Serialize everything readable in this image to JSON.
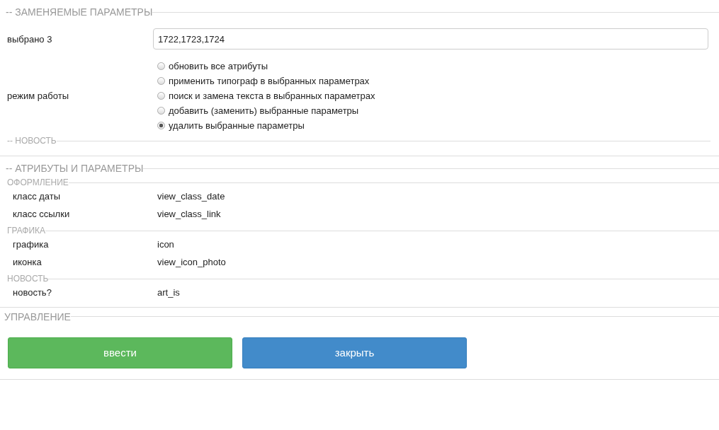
{
  "replace_section": {
    "legend": "-- ЗАМЕНЯЕМЫЕ ПАРАМЕТРЫ",
    "selected_label": "выбрано 3",
    "selected_value": "1722,1723,1724",
    "mode_label": "режим работы",
    "modes": [
      {
        "label": "обновить все атрибуты",
        "selected": false
      },
      {
        "label": "применить типограф в выбранных параметрах",
        "selected": false
      },
      {
        "label": "поиск и замена текста в выбранных параметрах",
        "selected": false
      },
      {
        "label": "добавить (заменить) выбранные параметры",
        "selected": false
      },
      {
        "label": "удалить выбранные параметры",
        "selected": true
      }
    ],
    "sub_legend": "-- НОВОСТЬ"
  },
  "attributes_section": {
    "legend": "-- АТРИБУТЫ И ПАРАМЕТРЫ",
    "groups": [
      {
        "legend": "ОФОРМЛЕНИЕ",
        "rows": [
          {
            "label": "класс даты",
            "value": "view_class_date"
          },
          {
            "label": "класс ссылки",
            "value": "view_class_link"
          }
        ]
      },
      {
        "legend": "ГРАФИКА",
        "rows": [
          {
            "label": "графика",
            "value": "icon"
          },
          {
            "label": "иконка",
            "value": "view_icon_photo"
          }
        ]
      },
      {
        "legend": "НОВОСТЬ",
        "rows": [
          {
            "label": "новость?",
            "value": "art_is"
          }
        ]
      }
    ]
  },
  "control_section": {
    "legend": "УПРАВЛЕНИЕ",
    "buttons": [
      {
        "label": "ввести",
        "kind": "submit"
      },
      {
        "label": "закрыть",
        "kind": "close"
      }
    ]
  }
}
